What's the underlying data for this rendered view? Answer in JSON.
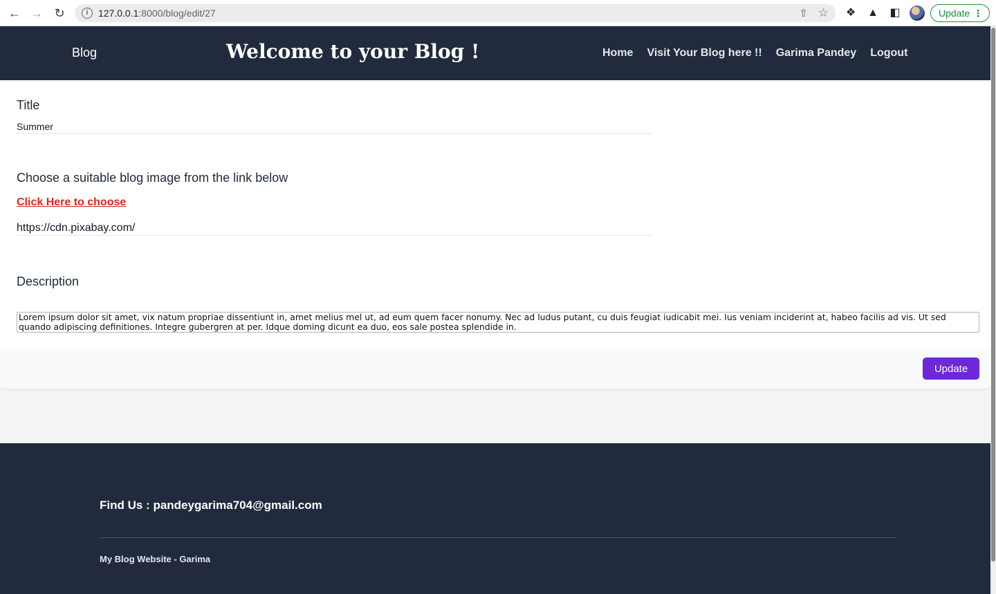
{
  "browser": {
    "url_host": "127.0.0.1",
    "url_path": ":8000/blog/edit/27",
    "update_label": "Update"
  },
  "header": {
    "brand": "Blog",
    "title": "Welcome to your Blog !",
    "nav": [
      "Home",
      "Visit Your Blog here !!",
      "Garima Pandey",
      "Logout"
    ]
  },
  "form": {
    "title_label": "Title",
    "title_value": "Summer",
    "image_label": "Choose a suitable blog image from the link below",
    "image_link": "Click Here to choose",
    "image_value": "https://cdn.pixabay.com/",
    "description_label": "Description",
    "description_value": "Lorem ipsum dolor sit amet, vix natum propriae dissentiunt in, amet melius mel ut, ad eum quem facer nonumy. Nec ad ludus putant, cu duis feugiat iudicabit mei. Ius veniam inciderint at, habeo facilis ad vis. Ut sed quando adipiscing definitiones. Integre gubergren at per. Idque doming dicunt ea duo, eos sale postea splendide in.",
    "submit_label": "Update"
  },
  "footer": {
    "find_us": "Find Us : pandeygarima704@gmail.com",
    "copyright": "My Blog Website - Garima"
  }
}
